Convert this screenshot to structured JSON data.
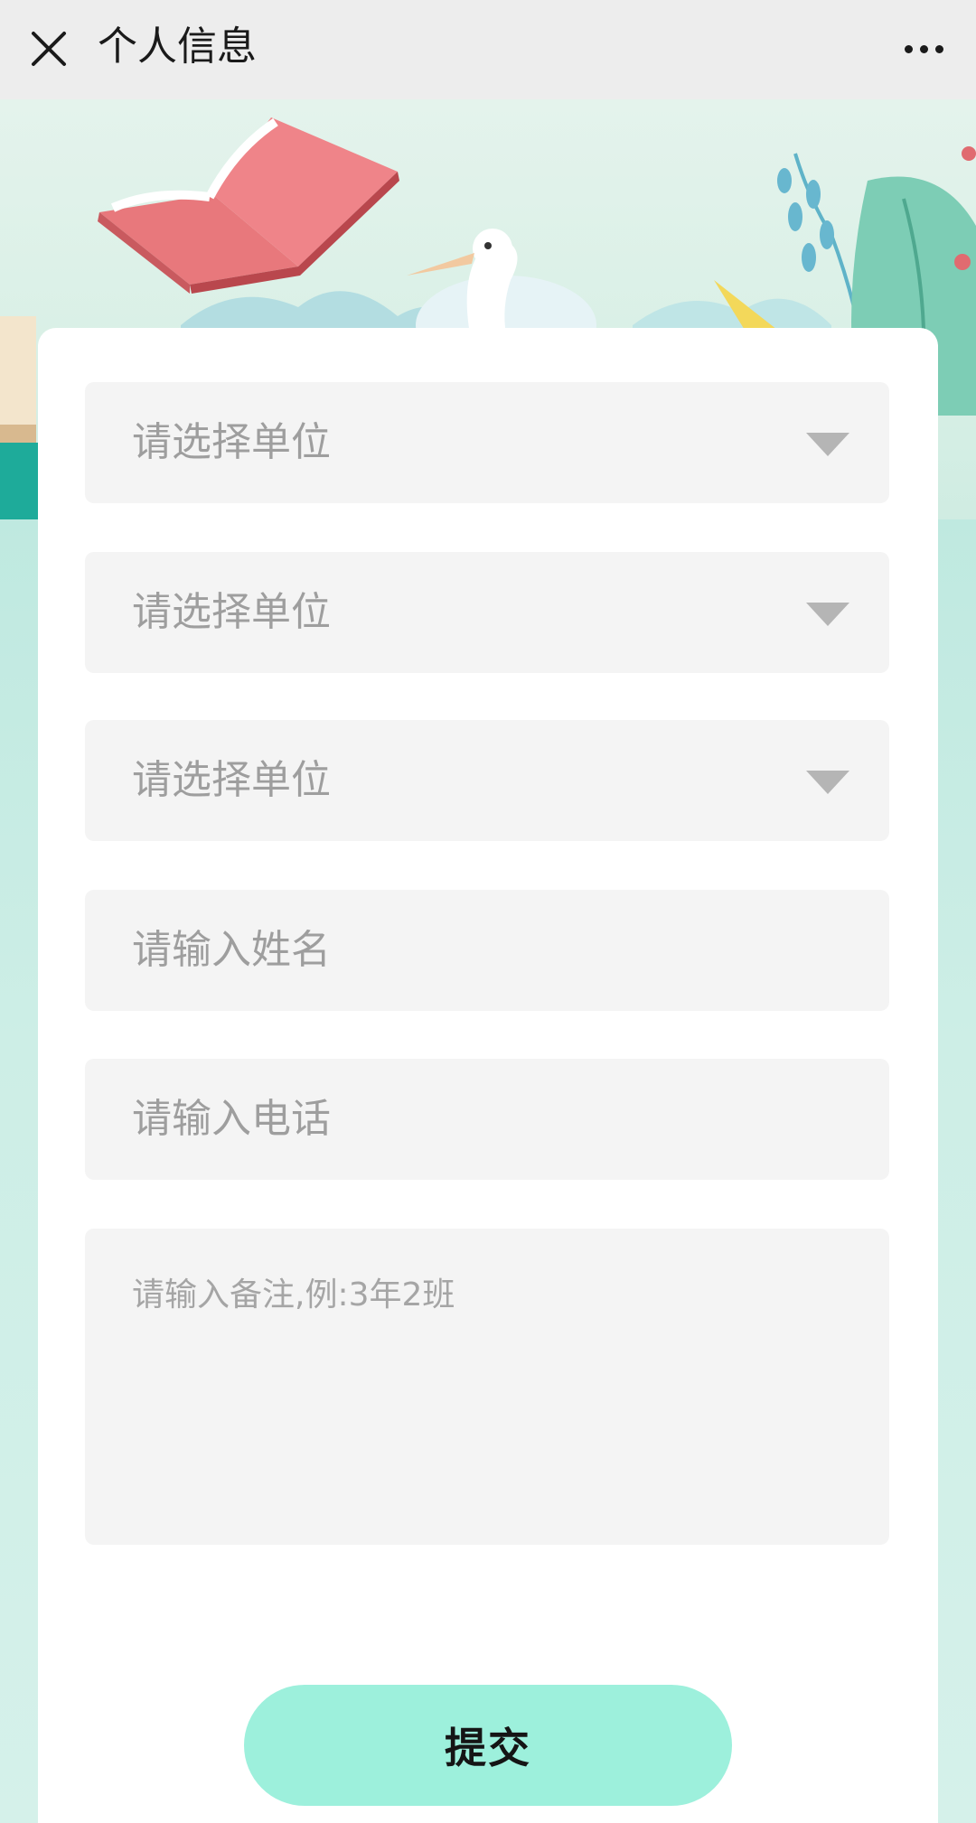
{
  "navbar": {
    "title": "个人信息",
    "close_icon": "close-icon",
    "more_icon": "more-dots-icon"
  },
  "form": {
    "selects": [
      {
        "placeholder": "请选择单位"
      },
      {
        "placeholder": "请选择单位"
      },
      {
        "placeholder": "请选择单位"
      }
    ],
    "name_placeholder": "请输入姓名",
    "phone_placeholder": "请输入电话",
    "note_placeholder": "请输入备注,例:3年2班",
    "submit_label": "提交"
  },
  "colors": {
    "submit_bg": "#9df0dc",
    "field_bg": "#f4f4f4",
    "placeholder": "#9e9e9e",
    "navbar_bg": "#ededed"
  }
}
